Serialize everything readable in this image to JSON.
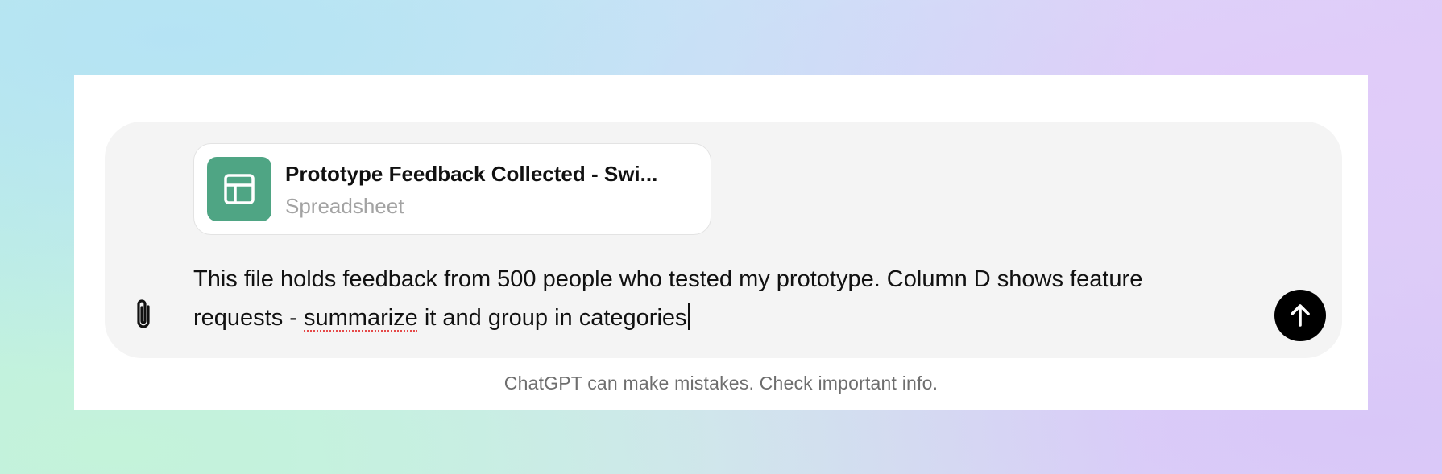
{
  "attachment": {
    "file_name": "Prototype Feedback Collected - Swi...",
    "file_type": "Spreadsheet",
    "icon": "spreadsheet-icon",
    "icon_color": "#4fa584"
  },
  "composer": {
    "message_before": "This file holds feedback from 500 people who tested my prototype. Column D shows feature requests - ",
    "message_misspelled": "summarize",
    "message_after": " it and group in categories",
    "attach_icon": "paperclip-icon",
    "send_icon": "arrow-up-icon"
  },
  "footer": {
    "disclaimer": "ChatGPT can make mistakes. Check important info."
  }
}
